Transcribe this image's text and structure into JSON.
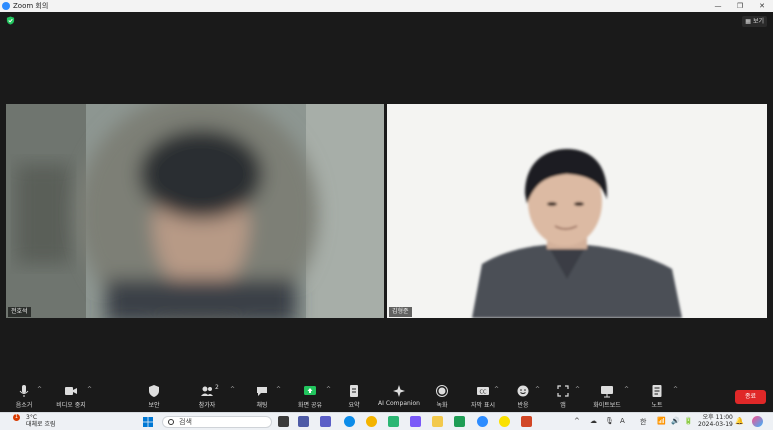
{
  "window": {
    "title": "Zoom 회의",
    "controls": [
      "minimize",
      "restore",
      "close"
    ]
  },
  "header": {
    "view_label": "보기"
  },
  "participants": [
    {
      "name": "전호석"
    },
    {
      "name": "김형준"
    }
  ],
  "toolbar": {
    "mute": "음소거",
    "video": "비디오 중지",
    "security": "보안",
    "participants": "참가자",
    "participants_count": "2",
    "chat": "채팅",
    "share": "화면 공유",
    "summary": "요약",
    "ai": "AI Companion",
    "record": "녹화",
    "captions": "자막 표시",
    "reactions": "반응",
    "apps": "앱",
    "whiteboard": "화이트보드",
    "notes": "노트",
    "end": "종료"
  },
  "taskbar": {
    "weather_temp": "3°C",
    "weather_desc": "대체로 흐림",
    "weather_badge": "1",
    "search_placeholder": "검색",
    "time": "오후 11:00",
    "date": "2024-03-19",
    "ime": "한",
    "font_indicator": "A"
  },
  "colors": {
    "end_button": "#e02828",
    "share_accent": "#22c55e",
    "zoom_blue": "#2d8cff"
  }
}
